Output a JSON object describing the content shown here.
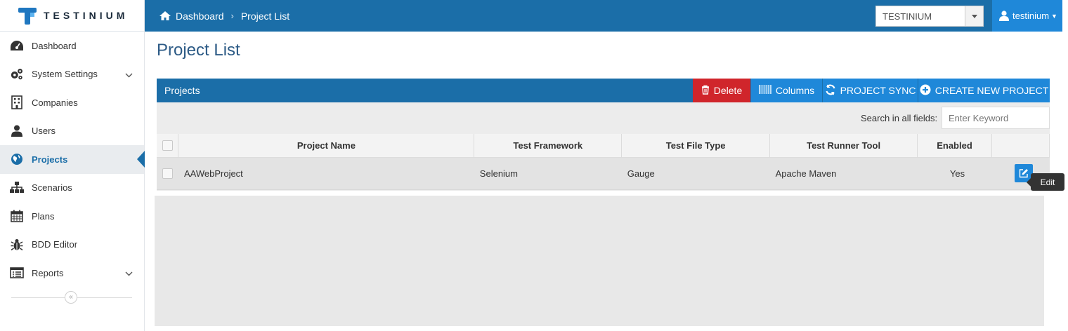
{
  "brand": {
    "name": "TESTINIUM"
  },
  "breadcrumb": {
    "home": "Dashboard",
    "current": "Project List"
  },
  "company_select": {
    "value": "TESTINIUM"
  },
  "user": {
    "name": "testinium"
  },
  "sidebar": {
    "items": [
      {
        "label": "Dashboard",
        "icon": "dashboard-icon"
      },
      {
        "label": "System Settings",
        "icon": "gears-icon",
        "expandable": true
      },
      {
        "label": "Companies",
        "icon": "building-icon"
      },
      {
        "label": "Users",
        "icon": "user-icon"
      },
      {
        "label": "Projects",
        "icon": "globe-icon",
        "active": true
      },
      {
        "label": "Scenarios",
        "icon": "sitemap-icon"
      },
      {
        "label": "Plans",
        "icon": "calendar-icon"
      },
      {
        "label": "BDD Editor",
        "icon": "bug-icon"
      },
      {
        "label": "Reports",
        "icon": "list-icon",
        "expandable": true
      }
    ],
    "collapse_glyph": "«"
  },
  "page": {
    "title": "Project List"
  },
  "panel": {
    "title": "Projects",
    "buttons": {
      "delete": "Delete",
      "columns": "Columns",
      "sync": "PROJECT SYNC",
      "create": "CREATE NEW PROJECT"
    },
    "search": {
      "label": "Search in all fields:",
      "placeholder": "Enter Keyword"
    }
  },
  "table": {
    "headers": [
      "Project Name",
      "Test Framework",
      "Test File Type",
      "Test Runner Tool",
      "Enabled"
    ],
    "rows": [
      {
        "name": "AAWebProject",
        "framework": "Selenium",
        "file_type": "Gauge",
        "runner": "Apache Maven",
        "enabled": "Yes"
      }
    ]
  },
  "tooltip": {
    "text": "Edit"
  },
  "colors": {
    "primary": "#1b6ea8",
    "accent": "#1f88d9",
    "danger": "#d0252b"
  }
}
